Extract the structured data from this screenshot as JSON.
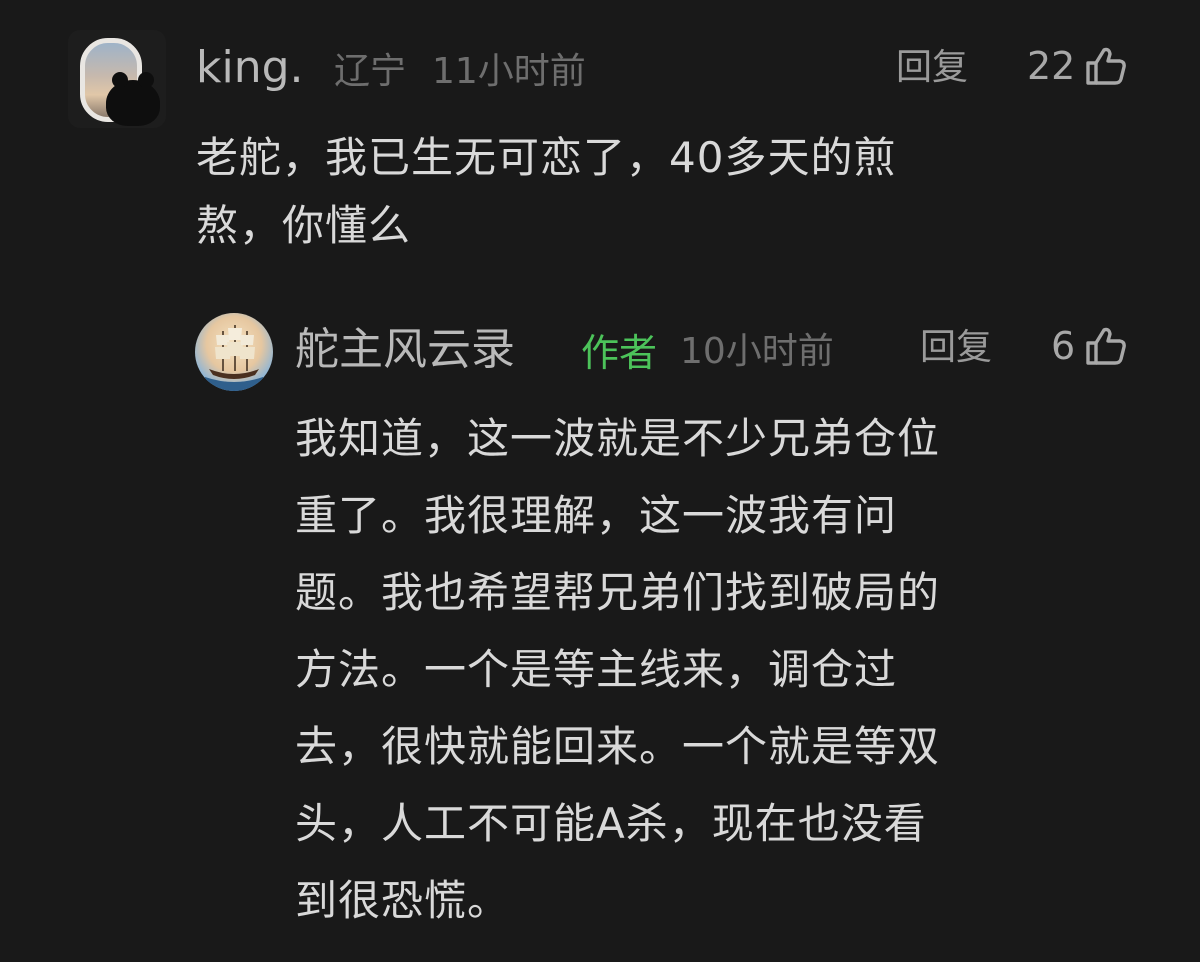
{
  "comment": {
    "username": "king.",
    "location": "辽宁",
    "time": "11小时前",
    "reply_label": "回复",
    "likes": "22",
    "text_lines": [
      "老舵，我已生无可恋了，40多天的煎",
      "熬，你懂么"
    ]
  },
  "reply": {
    "username": "舵主风云录",
    "author_badge": "作者",
    "time": "10小时前",
    "reply_label": "回复",
    "likes": "6",
    "text_lines": [
      "我知道，这一波就是不少兄弟仓位",
      "重了。我很理解，这一波我有问",
      "题。我也希望帮兄弟们找到破局的",
      "方法。一个是等主线来，调仓过",
      "去，很快就能回来。一个就是等双",
      "头，人工不可能A杀，现在也没看",
      "到很恐慌。"
    ]
  },
  "icons": {
    "like": "thumbs-up-outline-icon"
  },
  "colors": {
    "background": "#191919",
    "author_badge": "#4cc35a",
    "meta": "#6e6e6e",
    "text": "#d9d9d9"
  }
}
